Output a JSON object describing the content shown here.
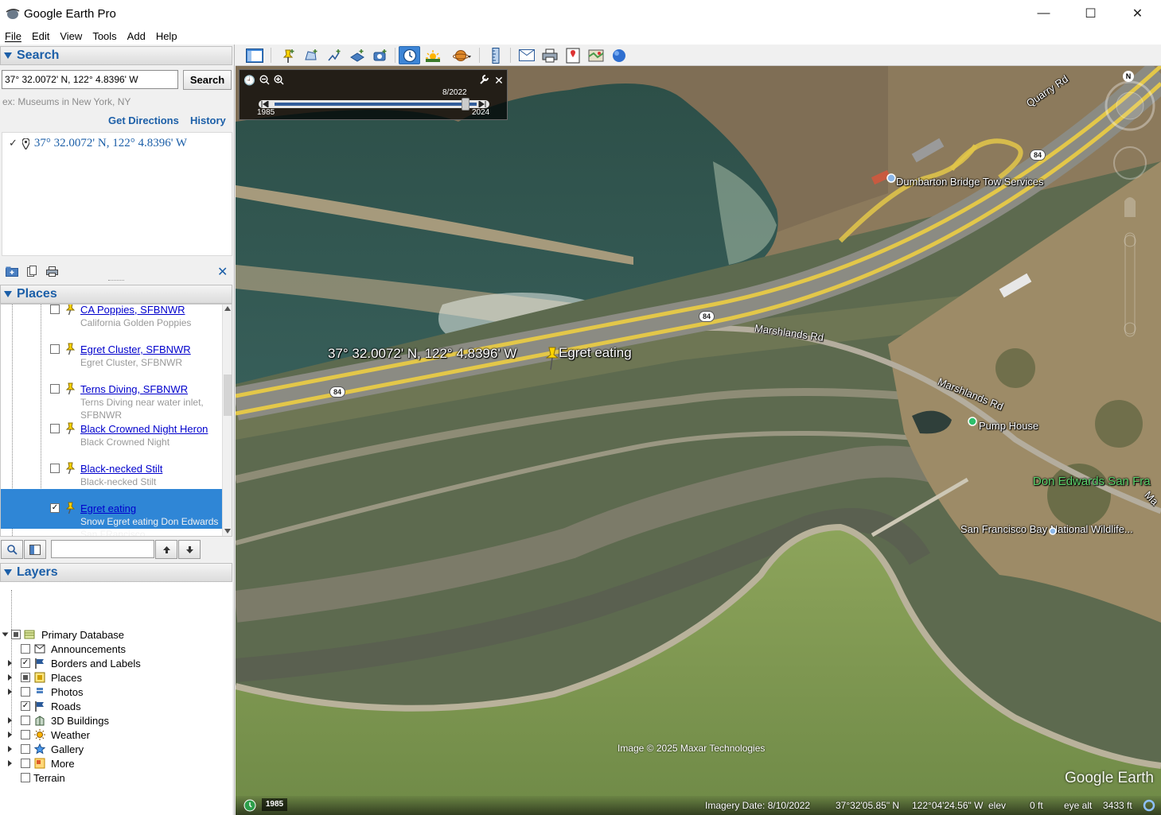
{
  "window": {
    "title": "Google Earth Pro",
    "minimize": "—",
    "maximize": "☐",
    "close": "✕"
  },
  "menu": [
    "File",
    "Edit",
    "View",
    "Tools",
    "Add",
    "Help"
  ],
  "search": {
    "header": "Search",
    "query": "37° 32.0072' N, 122° 4.8396' W",
    "button": "Search",
    "hint": "ex: Museums in New York, NY",
    "get_directions": "Get Directions",
    "history": "History",
    "result": "37° 32.0072' N, 122° 4.8396' W"
  },
  "places": {
    "header": "Places",
    "items": [
      {
        "name": "CA Poppies, SFBNWR",
        "desc": "California Golden Poppies",
        "checked": false
      },
      {
        "name": "Egret Cluster, SFBNWR",
        "desc": "Egret Cluster, SFBNWR",
        "checked": false
      },
      {
        "name": "Terns Diving, SFBNWR",
        "desc": "Terns Diving near water inlet, SFBNWR",
        "checked": false
      },
      {
        "name": "Black Crowned Night Heron",
        "desc": "Black Crowned Night",
        "checked": false
      },
      {
        "name": "Black-necked Stilt",
        "desc": "Black-necked Stilt",
        "checked": false
      },
      {
        "name": "Egret eating",
        "desc": "Snow Egret eating Don Edwards San FRancisco",
        "checked": true,
        "selected": true
      }
    ],
    "scroll_position": 0.35
  },
  "layers": {
    "header": "Layers",
    "items": [
      {
        "label": "Primary Database",
        "checked": "partial",
        "expandable": true,
        "expanded": true,
        "icon": "database-icon"
      },
      {
        "label": "Announcements",
        "checked": false,
        "expandable": false,
        "icon": "envelope-icon"
      },
      {
        "label": "Borders and Labels",
        "checked": true,
        "expandable": true,
        "icon": "flag-icon"
      },
      {
        "label": "Places",
        "checked": "partial",
        "expandable": true,
        "icon": "places-icon"
      },
      {
        "label": "Photos",
        "checked": false,
        "expandable": true,
        "icon": "photo-icon"
      },
      {
        "label": "Roads",
        "checked": true,
        "expandable": false,
        "icon": "road-icon"
      },
      {
        "label": "3D Buildings",
        "checked": false,
        "expandable": true,
        "icon": "building-icon"
      },
      {
        "label": "Weather",
        "checked": false,
        "expandable": true,
        "icon": "sun-icon"
      },
      {
        "label": "Gallery",
        "checked": false,
        "expandable": true,
        "icon": "star-icon"
      },
      {
        "label": "More",
        "checked": false,
        "expandable": true,
        "icon": "folder-icon"
      },
      {
        "label": "Terrain",
        "checked": false,
        "expandable": false,
        "icon": ""
      }
    ]
  },
  "toolbar": {
    "buttons": [
      "sidebar-toggle",
      "add-placemark",
      "add-polygon",
      "add-path",
      "add-image-overlay",
      "record-tour",
      "historical-imagery",
      "sunlight",
      "switch-planet",
      "ruler",
      "email",
      "print",
      "save-image",
      "view-in-maps",
      "web-globe"
    ],
    "active": [
      "historical-imagery"
    ]
  },
  "timeslider": {
    "current": "8/2022",
    "start": "1985",
    "end": "2024",
    "position": 0.94
  },
  "map": {
    "coordinate_label": "37° 32.0072' N, 122° 4.8396' W",
    "placemark_label": "Egret eating",
    "labels": {
      "quarry_rd": "Quarry Rd",
      "dumbarton": "Dumbarton Bridge Tow Services",
      "marshlands1": "Marshlands Rd",
      "marshlands2": "Marshlands Rd",
      "pump_house": "Pump House",
      "don_edwards": "Don Edwards San Fra",
      "sf_bay": "San Francisco Bay National Wildlife...",
      "ma": "Ma"
    },
    "shields": [
      "84",
      "84",
      "84"
    ],
    "north": "N",
    "attribution": "Image © 2025 Maxar Technologies",
    "brand": "Google Earth"
  },
  "status": {
    "year_badge": "1985",
    "imagery_date": "Imagery Date: 8/10/2022",
    "lat": "37°32'05.85\" N",
    "lon": "122°04'24.56\" W",
    "elev_label": "elev",
    "elev_value": "0 ft",
    "eye_alt": "eye alt",
    "eye_alt_value": "3433 ft"
  }
}
